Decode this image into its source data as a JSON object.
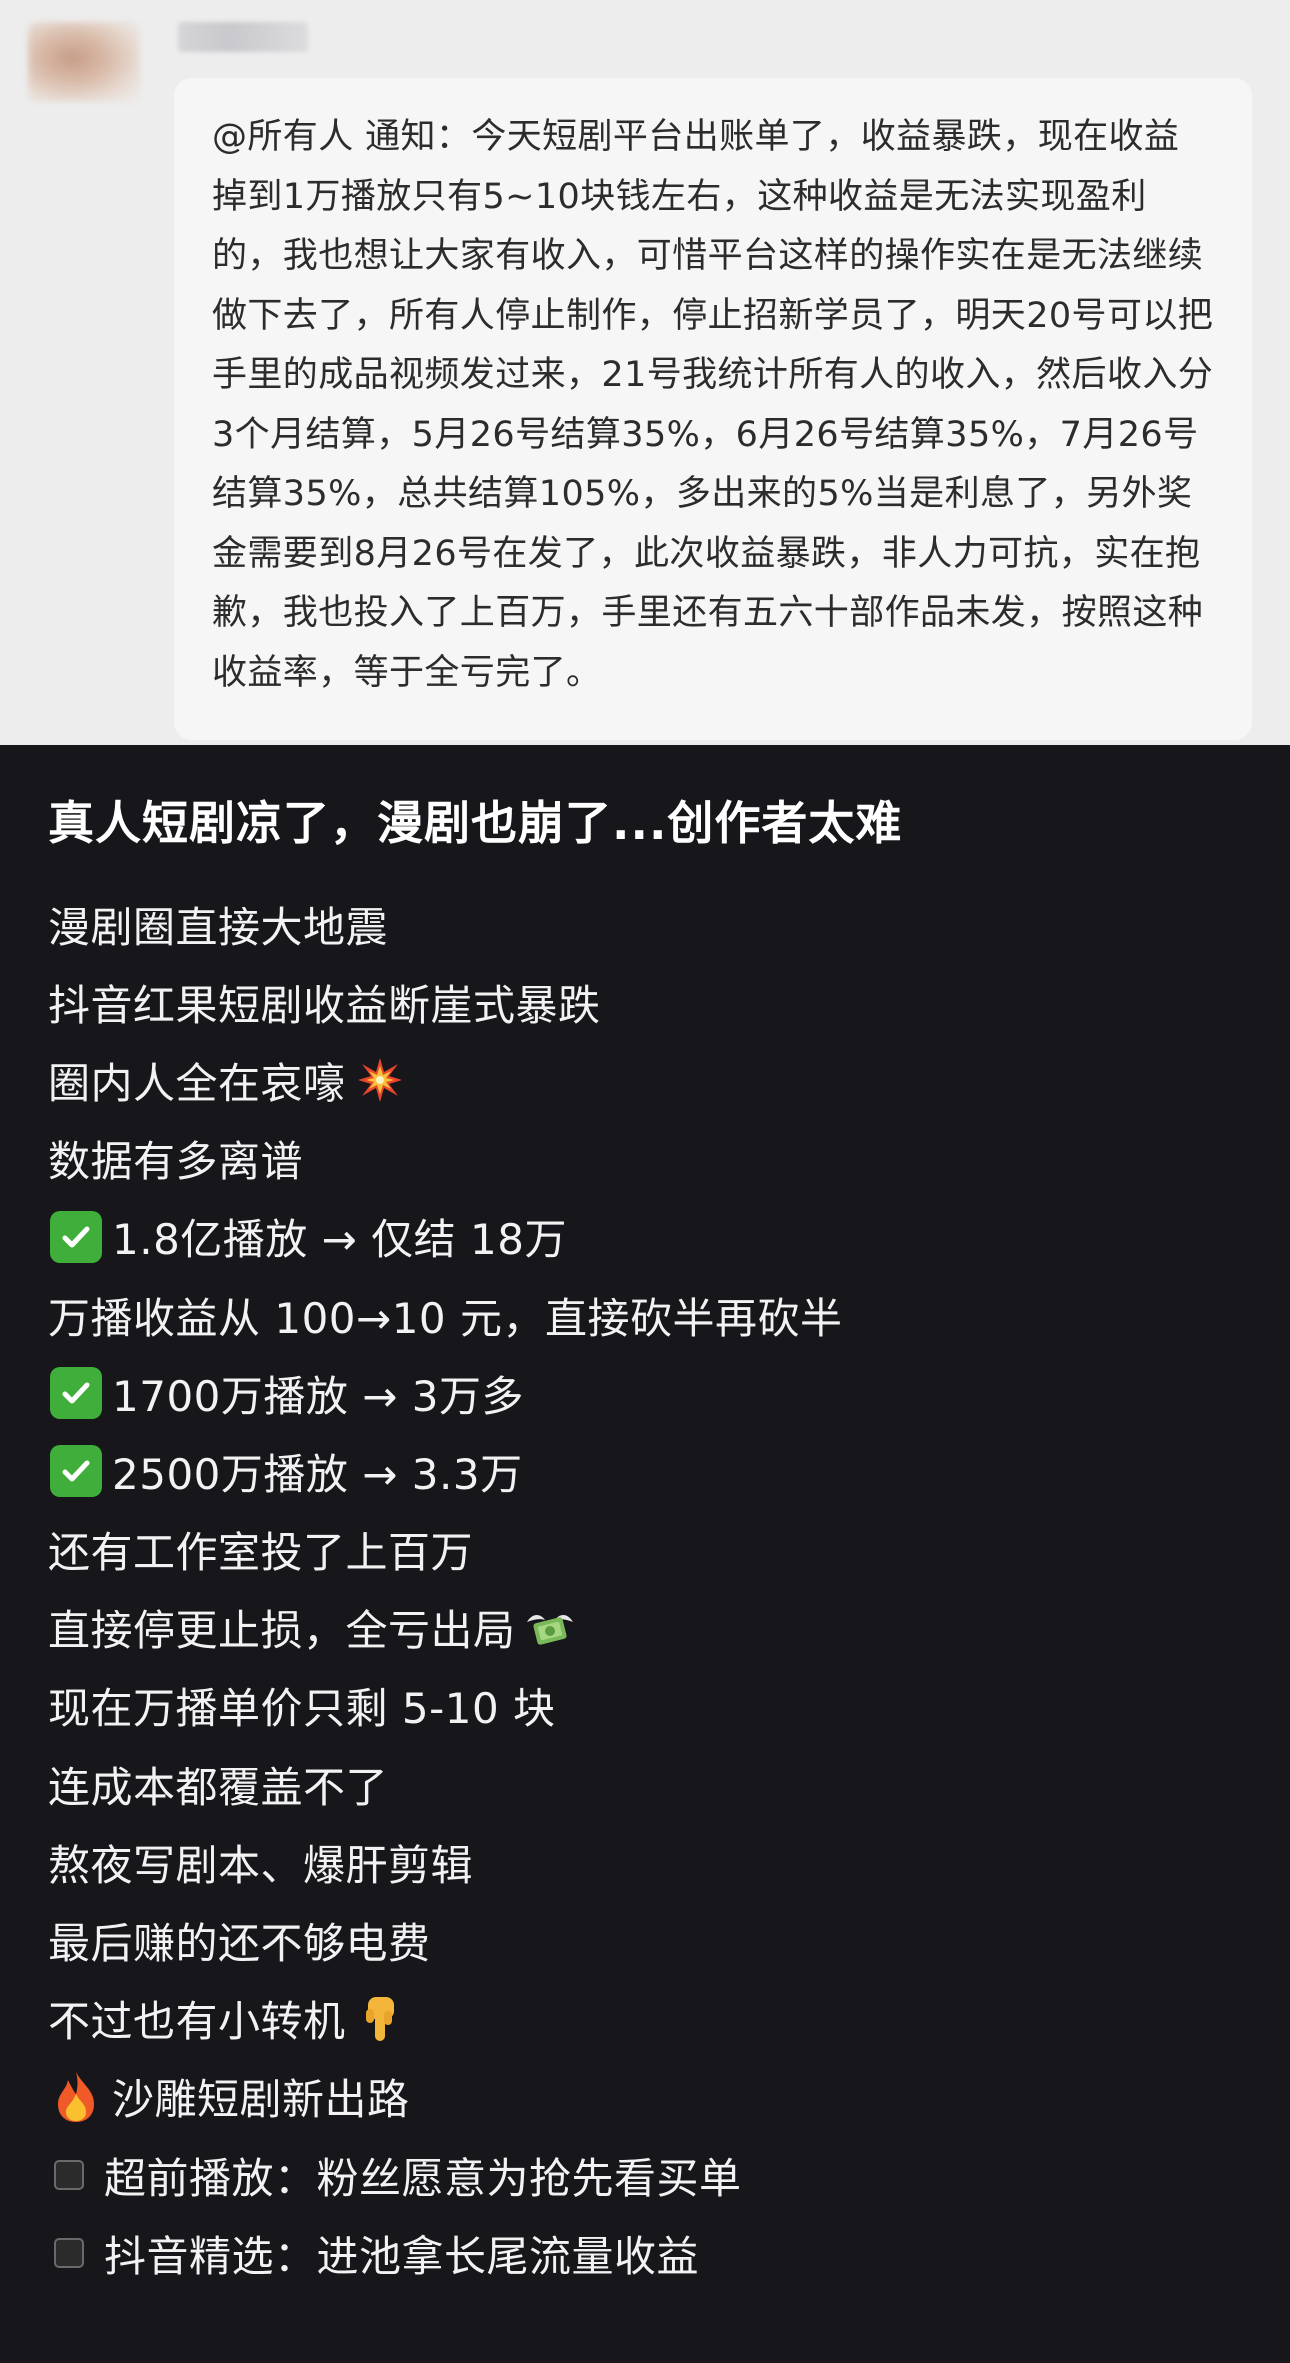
{
  "chat": {
    "message": "@所有人 通知：今天短剧平台出账单了，收益暴跌，现在收益掉到1万播放只有5~10块钱左右，这种收益是无法实现盈利的，我也想让大家有收入，可惜平台这样的操作实在是无法继续做下去了，所有人停止制作，停止招新学员了，明天20号可以把手里的成品视频发过来，21号我统计所有人的收入，然后收入分3个月结算，5月26号结算35%，6月26号结算35%，7月26号结算35%，总共结算105%，多出来的5%当是利息了，另外奖金需要到8月26号在发了，此次收益暴跌，非人力可抗，实在抱歉，我也投入了上百万，手里还有五六十部作品未发，按照这种收益率，等于全亏完了。"
  },
  "post": {
    "title": "真人短剧凉了，漫剧也崩了...创作者太难",
    "lines": [
      {
        "text": "漫剧圈直接大地震"
      },
      {
        "text": "抖音红果短剧收益断崖式暴跌"
      },
      {
        "text": "圈内人全在哀嚎",
        "trail_icon": "collision-icon"
      },
      {
        "text": "数据有多离谱"
      },
      {
        "text": "1.8亿播放 → 仅结 18万",
        "lead_icon": "check-mark-icon"
      },
      {
        "text": "万播收益从 100→10 元，直接砍半再砍半"
      },
      {
        "text": "1700万播放 → 3万多",
        "lead_icon": "check-mark-icon"
      },
      {
        "text": "2500万播放 → 3.3万",
        "lead_icon": "check-mark-icon"
      },
      {
        "text": "还有工作室投了上百万"
      },
      {
        "text": "直接停更止损，全亏出局",
        "trail_icon": "money-with-wings-icon"
      },
      {
        "text": "现在万播单价只剩 5-10 块"
      },
      {
        "text": "连成本都覆盖不了"
      },
      {
        "text": "熬夜写剧本、爆肝剪辑"
      },
      {
        "text": "最后赚的还不够电费"
      },
      {
        "text": "不过也有小转机",
        "trail_icon": "pointing-down-icon"
      },
      {
        "text": "沙雕短剧新出路",
        "lead_icon": "fire-icon"
      },
      {
        "text": "超前播放：粉丝愿意为抢先看买单",
        "lead_icon": "square-bullet-icon"
      },
      {
        "text": "抖音精选：进池拿长尾流量收益",
        "lead_icon": "square-bullet-icon"
      }
    ]
  },
  "colors": {
    "chat_bg": "#ededed",
    "bubble_bg": "#f6f6f6",
    "post_bg": "#16161b",
    "check_green": "#3fae3a"
  }
}
